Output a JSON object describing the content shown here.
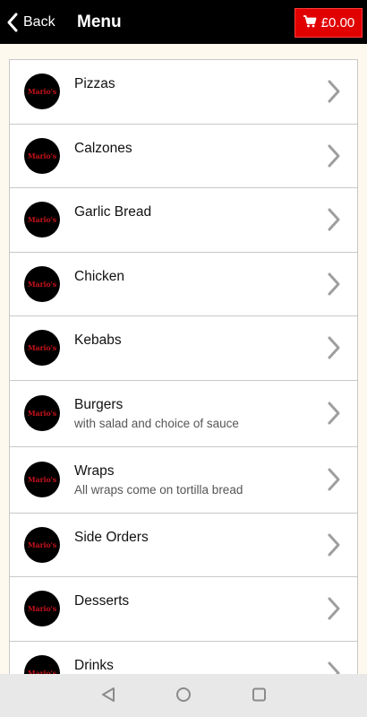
{
  "header": {
    "back_label": "Back",
    "title": "Menu",
    "cart_total": "£0.00"
  },
  "menu": {
    "logo_text": "Mario's",
    "items": [
      {
        "title": "Pizzas",
        "subtitle": ""
      },
      {
        "title": "Calzones",
        "subtitle": ""
      },
      {
        "title": "Garlic Bread",
        "subtitle": ""
      },
      {
        "title": "Chicken",
        "subtitle": ""
      },
      {
        "title": "Kebabs",
        "subtitle": ""
      },
      {
        "title": "Burgers",
        "subtitle": "with salad and choice of sauce"
      },
      {
        "title": "Wraps",
        "subtitle": "All wraps come on tortilla bread"
      },
      {
        "title": "Side Orders",
        "subtitle": ""
      },
      {
        "title": "Desserts",
        "subtitle": ""
      },
      {
        "title": "Drinks",
        "subtitle": ""
      }
    ]
  },
  "colors": {
    "topbar": "#000000",
    "cart_button": "#e10000",
    "page_background": "#fdf9ee"
  },
  "icons": {
    "back": "chevron-left-icon",
    "cart": "cart-icon",
    "item_arrow": "chevron-right-icon",
    "nav_back": "triangle-back-icon",
    "nav_home": "circle-home-icon",
    "nav_recents": "square-recents-icon"
  }
}
